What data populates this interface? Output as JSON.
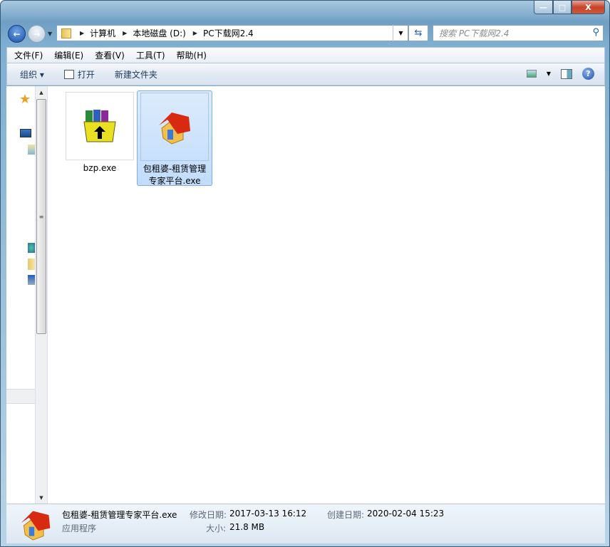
{
  "window": {
    "minimize_label": "—",
    "maximize_label": "□",
    "close_label": "X"
  },
  "address": {
    "crumbs": [
      "计算机",
      "本地磁盘 (D:)",
      "PC下载网2.4"
    ]
  },
  "search": {
    "placeholder": "搜索 PC下载网2.4"
  },
  "menu": [
    "文件(F)",
    "编辑(E)",
    "查看(V)",
    "工具(T)",
    "帮助(H)"
  ],
  "toolbar": {
    "organize": "组织 ▾",
    "open": "打开",
    "new_folder": "新建文件夹"
  },
  "files": [
    {
      "name": "bzp.exe",
      "selected": false
    },
    {
      "name": "包租婆-租赁管理专家平台.exe",
      "selected": true
    }
  ],
  "details": {
    "filename": "包租婆-租赁管理专家平台.exe",
    "type": "应用程序",
    "modified_label": "修改日期:",
    "modified": "2017-03-13 16:12",
    "created_label": "创建日期:",
    "created": "2020-02-04 15:23",
    "size_label": "大小:",
    "size": "21.8 MB"
  }
}
